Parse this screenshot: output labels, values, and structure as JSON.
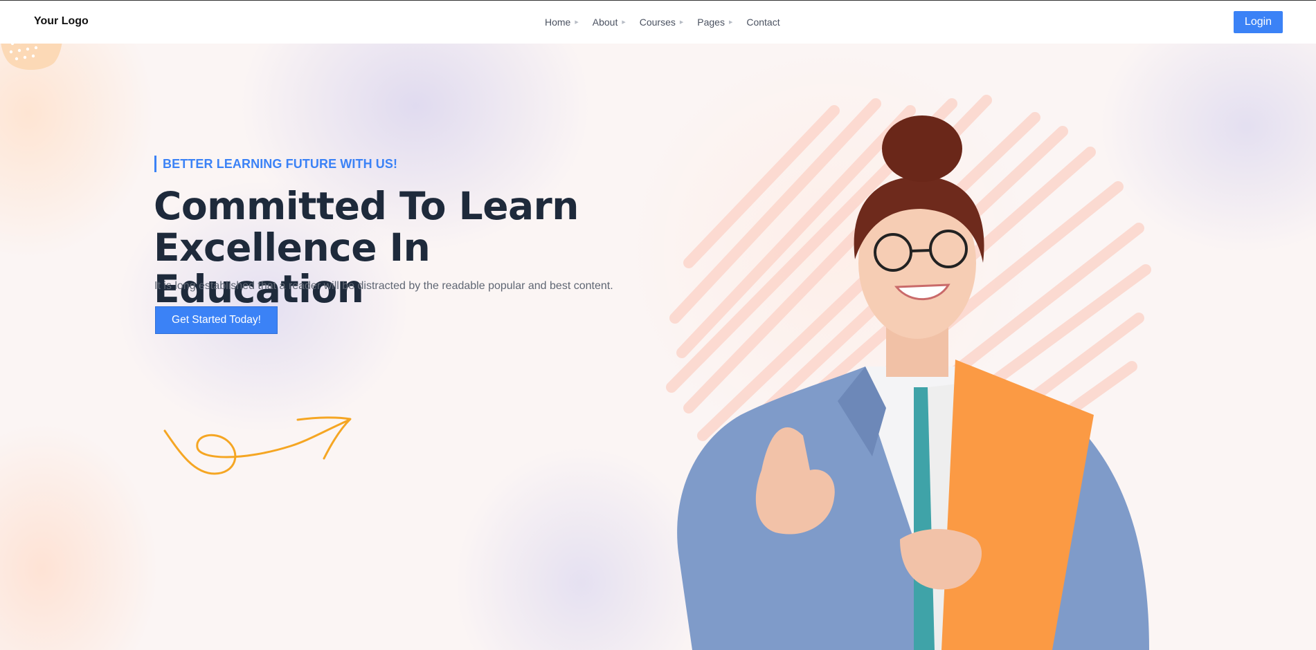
{
  "header": {
    "logo_text": "Your Logo",
    "nav": [
      {
        "label": "Home",
        "has_caret": true
      },
      {
        "label": "About",
        "has_caret": true
      },
      {
        "label": "Courses",
        "has_caret": true
      },
      {
        "label": "Pages",
        "has_caret": true
      },
      {
        "label": "Contact",
        "has_caret": false
      }
    ],
    "login_label": "Login"
  },
  "hero": {
    "tagline": "BETTER LEARNING FUTURE WITH US!",
    "title_line1": "Committed To Learn",
    "title_line2": "Excellence In Education",
    "subtitle": "It is long established that a reader will be distracted by the readable popular and best content.",
    "cta_label": "Get Started Today!"
  },
  "icons": {
    "nav_caret": "caret-right-icon",
    "logo_mark": "dotted-blob-icon",
    "arrow": "curly-arrow-icon"
  },
  "colors": {
    "accent": "#3b82f6",
    "heading": "#1e2a3b",
    "body_text": "#5f6673",
    "arrow_orange": "#f5a623",
    "scribble_pink": "#fcd6cc",
    "logo_blob": "#fcd9b6"
  }
}
